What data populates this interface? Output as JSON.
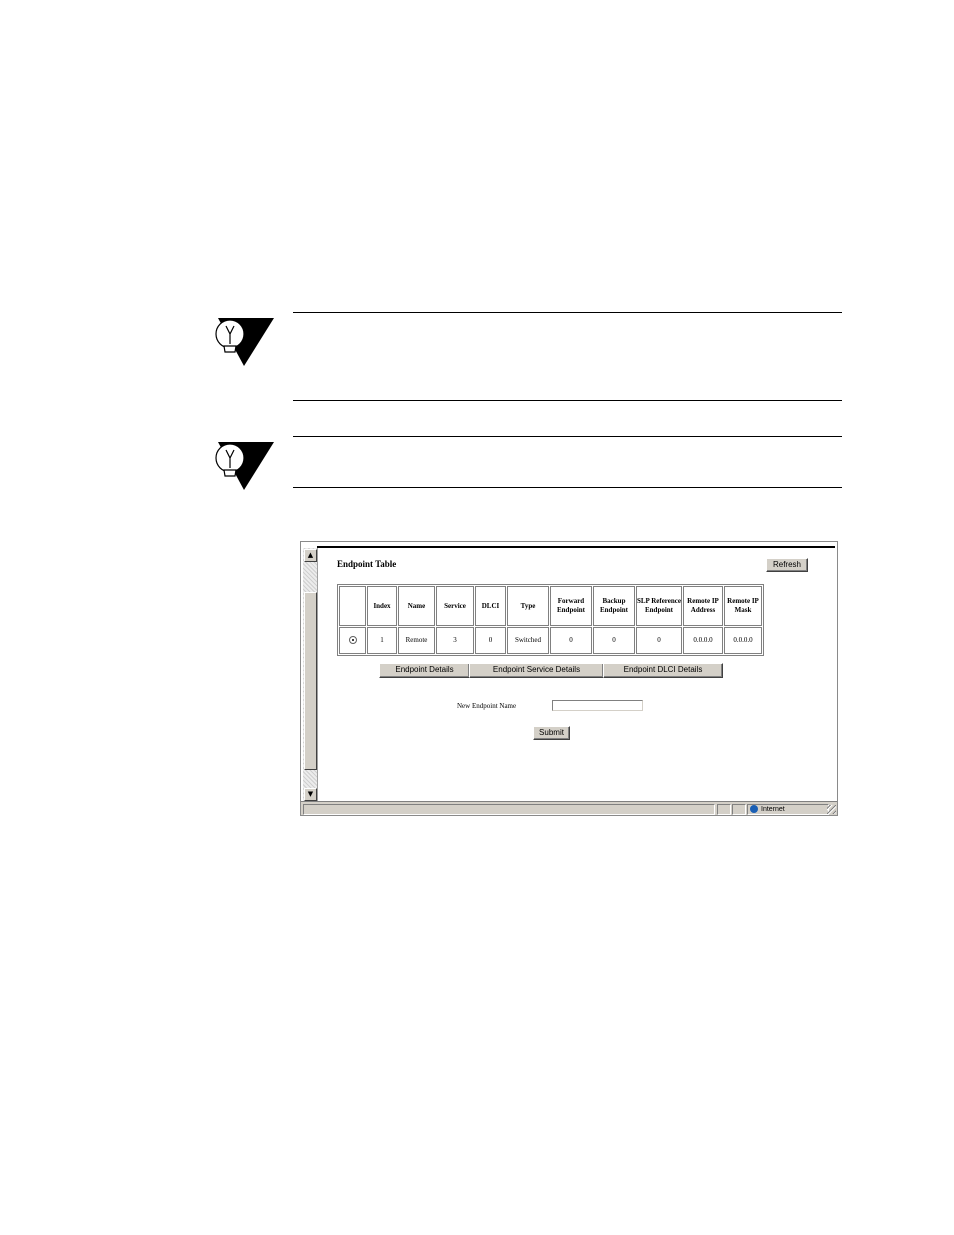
{
  "endpoint_page": {
    "title": "Endpoint Table",
    "refresh_label": "Refresh",
    "table": {
      "headers": [
        "",
        "Index",
        "Name",
        "Service",
        "DLCI",
        "Type",
        "Forward Endpoint",
        "Backup Endpoint",
        "SLP Reference Endpoint",
        "Remote IP Address",
        "Remote IP Mask"
      ],
      "rows": [
        [
          "",
          "1",
          "Remote",
          "3",
          "0",
          "Switched",
          "0",
          "0",
          "0",
          "0.0.0.0",
          "0.0.0.0"
        ]
      ]
    },
    "tabs": [
      "Endpoint Details",
      "Endpoint Service Details",
      "Endpoint DLCI Details"
    ],
    "new_name_label": "New Endpoint Name",
    "new_name_value": "",
    "submit_label": "Submit"
  },
  "statusbar": {
    "zone": "Internet"
  },
  "icons": {
    "note": "lightbulb-icon",
    "globe": "globe-icon"
  }
}
